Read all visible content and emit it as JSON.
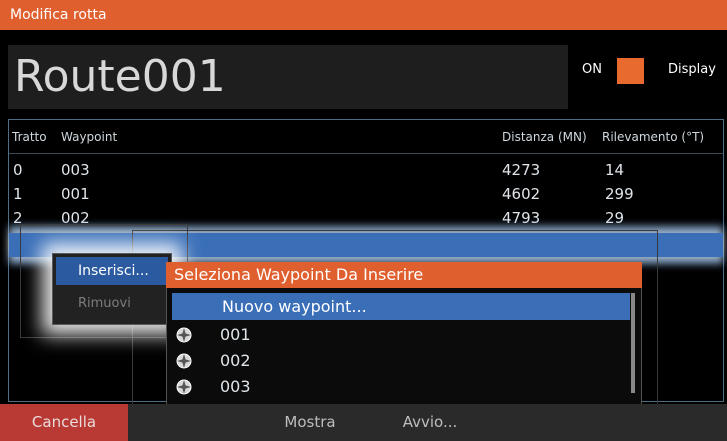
{
  "window": {
    "title": "Modifica rotta"
  },
  "route": {
    "name": "Route001"
  },
  "display_toggle": {
    "state_label": "ON",
    "label": "Display",
    "on_color": "#e96a2f"
  },
  "table": {
    "headers": {
      "leg": "Tratto",
      "waypoint": "Waypoint",
      "distance": "Distanza (MN)",
      "bearing": "Rilevamento (°T)"
    },
    "rows": [
      {
        "leg": "0",
        "waypoint": "003",
        "distance": "4273",
        "bearing": "14"
      },
      {
        "leg": "1",
        "waypoint": "001",
        "distance": "4602",
        "bearing": "299"
      },
      {
        "leg": "2",
        "waypoint": "002",
        "distance": "4793",
        "bearing": "29"
      }
    ]
  },
  "context_menu": {
    "insert": "Inserisci...",
    "remove": "Rimuovi"
  },
  "dialog": {
    "title": "Seleziona Waypoint Da Inserire",
    "new_option": "Nuovo waypoint...",
    "waypoints": [
      "001",
      "002",
      "003"
    ],
    "waypoint_icon": "waypoint-marker-icon"
  },
  "bottom": {
    "cancel": "Cancella",
    "show": "Mostra",
    "start": "Avvio..."
  },
  "colors": {
    "accent": "#e05f2e",
    "selection": "#3a6fb8",
    "cancel": "#b93a34"
  }
}
